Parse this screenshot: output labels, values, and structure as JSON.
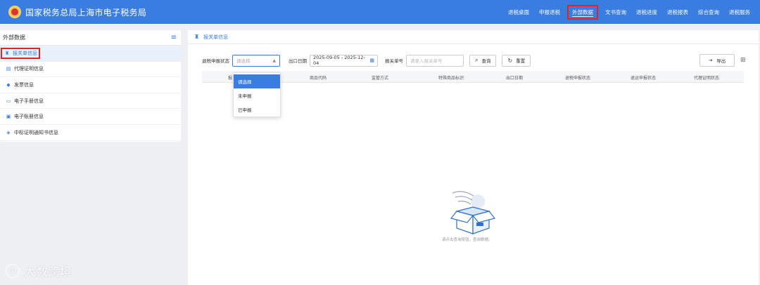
{
  "header": {
    "site_title": "国家税务总局上海市电子税务局",
    "nav": [
      "退税桌面",
      "申报退税",
      "外部数据",
      "文书查询",
      "退税进度",
      "退税报表",
      "综合查询",
      "退税服务"
    ],
    "active_nav_index": 2
  },
  "sidebar": {
    "title": "外部数据",
    "items": [
      {
        "label": "报关单信息",
        "active": true
      },
      {
        "label": "代理证明信息"
      },
      {
        "label": "发票信息"
      },
      {
        "label": "电子手册信息"
      },
      {
        "label": "电子账册信息"
      },
      {
        "label": "中标证明通知书信息"
      }
    ]
  },
  "main": {
    "breadcrumb": "报关单信息",
    "filters": {
      "status_label": "退税申报状态",
      "status_placeholder": "请选择",
      "date_label": "出口日期",
      "date_value": "2025-09-05 - 2025-12-04",
      "declaration_label": "报关单号",
      "declaration_placeholder": "请录入报关单号",
      "query_button": "查询",
      "reset_button": "重置",
      "export_button": "导出"
    },
    "table_columns": [
      "报",
      "商品代码",
      "监管方式",
      "特殊商品标识",
      "出口日期",
      "退税申报状态",
      "退运申报状态",
      "代理证明状态"
    ],
    "dropdown_options": [
      "请选择",
      "未申报",
      "已申报"
    ],
    "dropdown_selected_index": 0,
    "empty_text": "请点击查询按钮，查询数据。"
  },
  "watermark": "大数跨境",
  "colors": {
    "primary": "#3a7de0",
    "highlight_border": "#e02424",
    "background": "#eef0f3"
  }
}
